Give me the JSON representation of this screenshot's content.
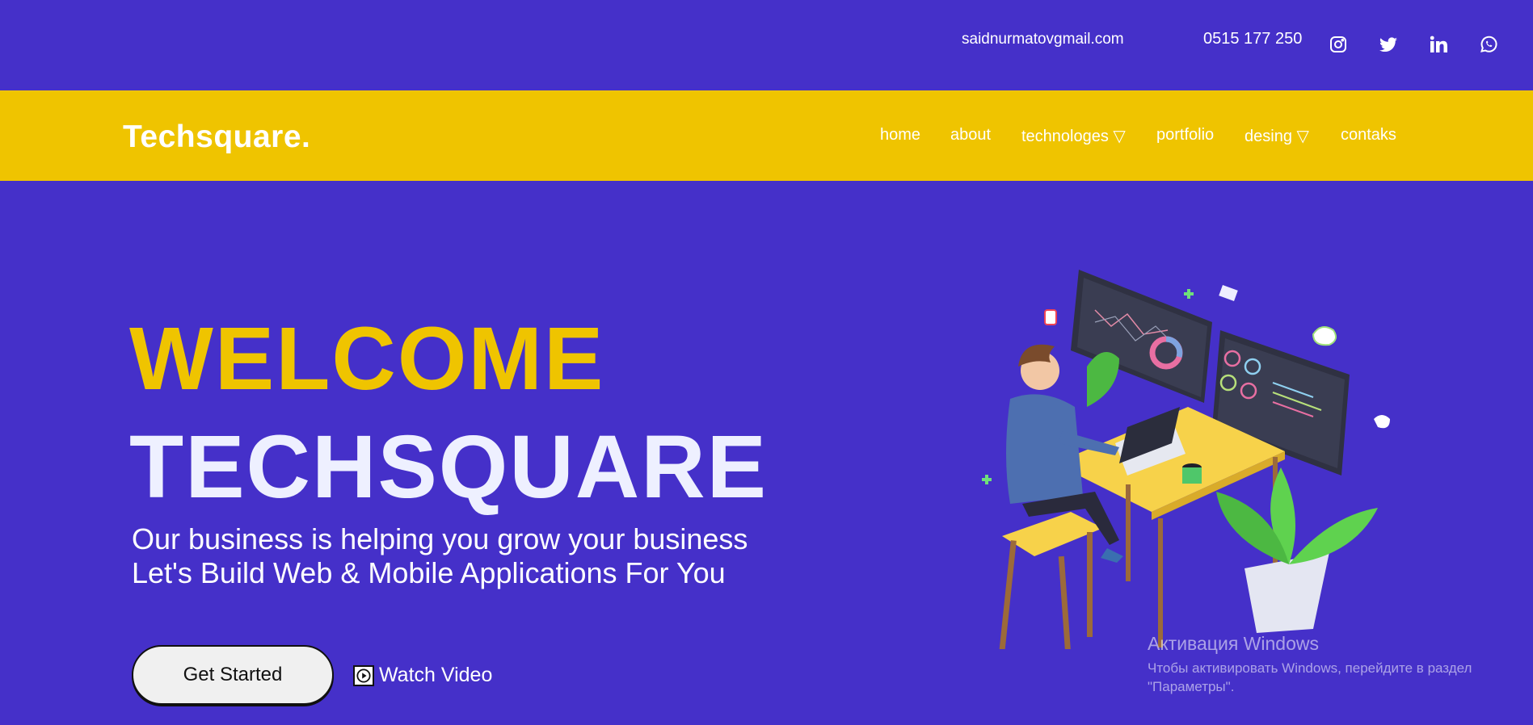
{
  "topbar": {
    "email": "saidnurmatovgmail.com",
    "phone": "0515 177 250",
    "social": [
      "instagram-icon",
      "twitter-icon",
      "linkedin-icon",
      "whatsapp-icon"
    ]
  },
  "navbar": {
    "logo": "Techsquare.",
    "items": [
      {
        "label": "home"
      },
      {
        "label": "about"
      },
      {
        "label": "technologes ▽"
      },
      {
        "label": "portfolio"
      },
      {
        "label": "desing ▽"
      },
      {
        "label": "contaks"
      }
    ]
  },
  "hero": {
    "welcome": "WELCOME",
    "brand": "TECHSQUARE",
    "subtitle_line1": "Our business is helping you grow your business",
    "subtitle_line2": "Let's Build Web & Mobile Applications For You",
    "cta_primary": "Get Started",
    "cta_secondary": "Watch Video"
  },
  "watermark": {
    "title": "Активация Windows",
    "text": "Чтобы активировать Windows, перейдите в раздел \"Параметры\"."
  },
  "colors": {
    "background": "#4530c9",
    "accent": "#efc400",
    "text": "#ffffff"
  }
}
